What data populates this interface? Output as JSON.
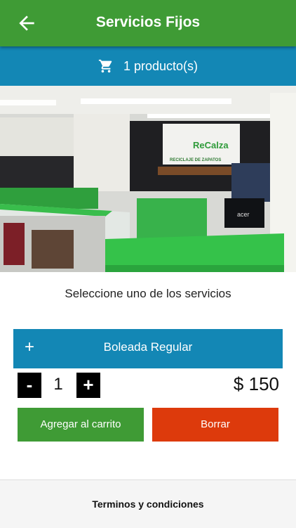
{
  "header": {
    "title": "Servicios Fijos",
    "back_icon": "arrow-back-icon"
  },
  "cart": {
    "icon": "cart-icon",
    "label": "1 producto(s)"
  },
  "colors": {
    "primary_green": "#3f9b35",
    "accent_blue": "#1387b5",
    "danger": "#dd3a0c"
  },
  "photo": {
    "logo_text": "ReCalza",
    "logo_subtext": "RECICLAJE DE ZAPATOS",
    "monitor_brand": "acer"
  },
  "main": {
    "prompt": "Seleccione uno de los servicios",
    "service": {
      "expand_icon": "plus-icon",
      "expand_symbol": "+",
      "name": "Boleada Regular"
    },
    "quantity": {
      "minus_label": "-",
      "value": "1",
      "plus_label": "+"
    },
    "price": "$ 150",
    "add_button_label": "Agregar al carrito",
    "delete_button_label": "Borrar"
  },
  "footer": {
    "terms_label": "Terminos y condiciones"
  }
}
